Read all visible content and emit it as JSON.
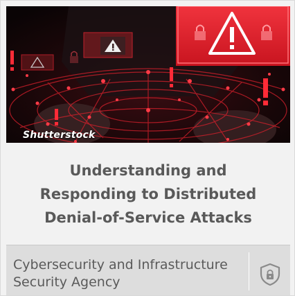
{
  "image": {
    "credit": "Shutterstock",
    "alert_icon": "warning-triangle-icon",
    "lock_icon": "padlock-icon",
    "accent_color": "#e02030"
  },
  "article": {
    "title": "Understanding and Responding to Distributed Denial-of-Service Attacks"
  },
  "footer": {
    "agency": "Cybersecurity and Infrastructure Security Agency",
    "icon": "shield-lock-icon"
  }
}
